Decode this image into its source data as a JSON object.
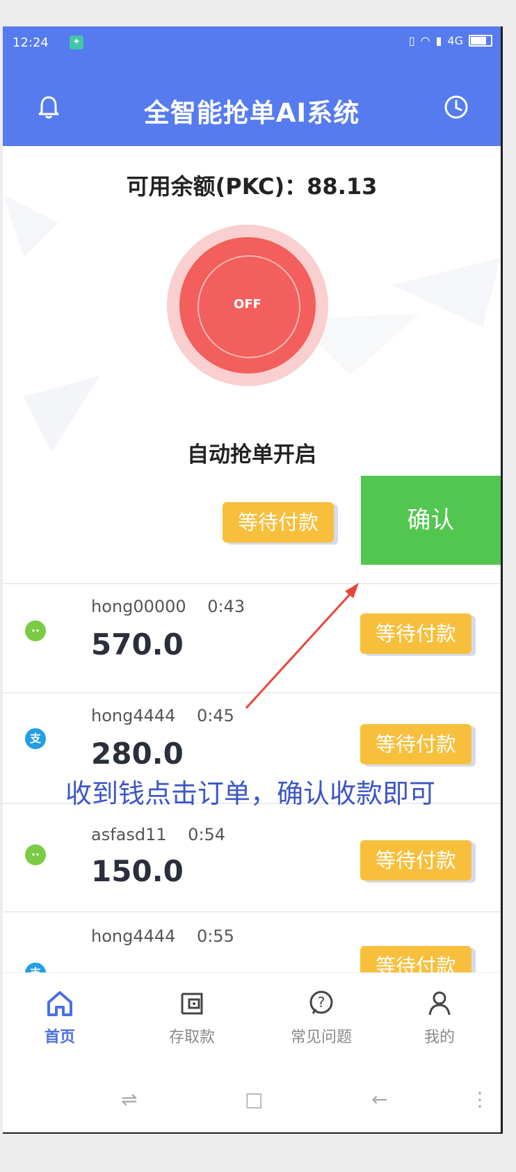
{
  "status_bar": {
    "time": "12:24",
    "network": "4G"
  },
  "header": {
    "title": "全智能抢单AI系统"
  },
  "balance": {
    "text": "可用余额(PKC)：88.13"
  },
  "power": {
    "state_label": "OFF",
    "caption": "自动抢单开启"
  },
  "swipe_row": {
    "status": "等待付款",
    "action": "确认"
  },
  "orders": [
    {
      "user": "hong00000",
      "time": "0:43",
      "amount": "570.0",
      "status": "等待付款",
      "pay_icon": "wechat-icon"
    },
    {
      "user": "hong4444",
      "time": "0:45",
      "amount": "280.0",
      "status": "等待付款",
      "pay_icon": "alipay-icon"
    },
    {
      "user": "asfasd11",
      "time": "0:54",
      "amount": "150.0",
      "status": "等待付款",
      "pay_icon": "wechat-icon"
    },
    {
      "user": "hong4444",
      "time": "0:55",
      "amount": "",
      "status": "等待付款",
      "pay_icon": "alipay-icon"
    }
  ],
  "annotation": "收到钱点击订单，确认收款即可",
  "bottom_nav": [
    {
      "label": "首页",
      "icon": "home-icon",
      "active": true
    },
    {
      "label": "存取款",
      "icon": "wallet-icon",
      "active": false
    },
    {
      "label": "常见问题",
      "icon": "help-icon",
      "active": false
    },
    {
      "label": "我的",
      "icon": "user-icon",
      "active": false
    }
  ],
  "colors": {
    "header": "#557bef",
    "power_button": "#f25f5c",
    "status_badge": "#f7bf3c",
    "confirm": "#53c650",
    "active_nav": "#4b6fe6"
  }
}
